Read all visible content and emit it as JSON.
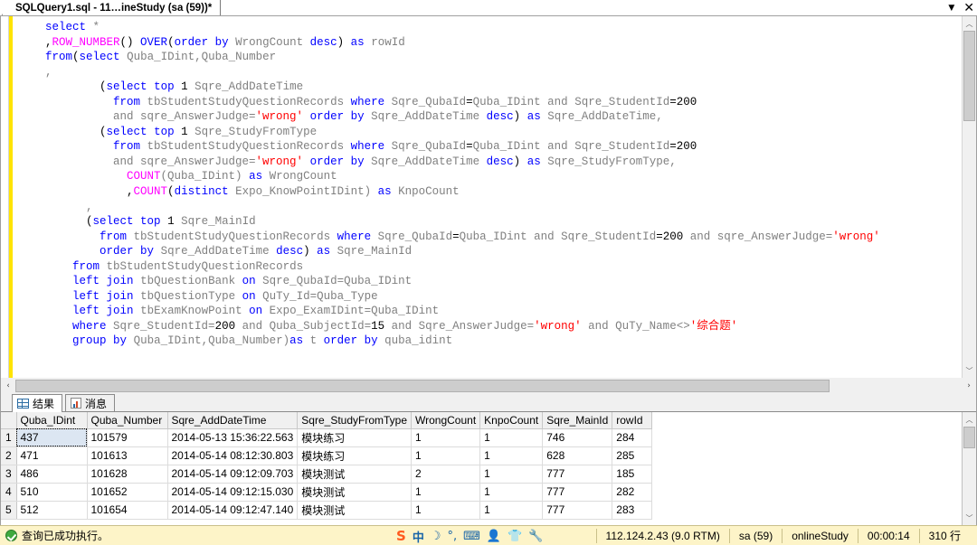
{
  "titlebar": {
    "tab_label": "SQLQuery1.sql - 11…ineStudy (sa (59))*",
    "chevron": "▼",
    "close": "✕"
  },
  "editor": {
    "lines": [
      [
        {
          "t": "    ",
          "c": "plain"
        },
        {
          "t": "select",
          "c": "kw"
        },
        {
          "t": " ",
          "c": "plain"
        },
        {
          "t": "*",
          "c": "id"
        }
      ],
      [
        {
          "t": "    ,",
          "c": "plain"
        },
        {
          "t": "ROW_NUMBER",
          "c": "fn"
        },
        {
          "t": "() ",
          "c": "plain"
        },
        {
          "t": "OVER",
          "c": "kw"
        },
        {
          "t": "(",
          "c": "plain"
        },
        {
          "t": "order",
          "c": "kw"
        },
        {
          "t": " ",
          "c": "plain"
        },
        {
          "t": "by",
          "c": "kw"
        },
        {
          "t": " WrongCount ",
          "c": "id"
        },
        {
          "t": "desc",
          "c": "kw"
        },
        {
          "t": ") ",
          "c": "plain"
        },
        {
          "t": "as",
          "c": "kw"
        },
        {
          "t": " rowId",
          "c": "id"
        }
      ],
      [
        {
          "t": "    ",
          "c": "plain"
        },
        {
          "t": "from",
          "c": "kw"
        },
        {
          "t": "(",
          "c": "plain"
        },
        {
          "t": "select",
          "c": "kw"
        },
        {
          "t": " Quba_IDint,Quba_Number",
          "c": "id"
        }
      ],
      [
        {
          "t": "    ,",
          "c": "id"
        }
      ],
      [
        {
          "t": "            (",
          "c": "plain"
        },
        {
          "t": "select",
          "c": "kw"
        },
        {
          "t": " ",
          "c": "plain"
        },
        {
          "t": "top",
          "c": "kw"
        },
        {
          "t": " ",
          "c": "plain"
        },
        {
          "t": "1",
          "c": "num"
        },
        {
          "t": " Sqre_AddDateTime",
          "c": "id"
        }
      ],
      [
        {
          "t": "              ",
          "c": "plain"
        },
        {
          "t": "from",
          "c": "kw"
        },
        {
          "t": " tbStudentStudyQuestionRecords ",
          "c": "id"
        },
        {
          "t": "where",
          "c": "kw"
        },
        {
          "t": " ",
          "c": "plain"
        },
        {
          "t": "Sqre_QubaId",
          "c": "id"
        },
        {
          "t": "=",
          "c": "plain"
        },
        {
          "t": "Quba_IDint",
          "c": "id"
        },
        {
          "t": " and ",
          "c": "id"
        },
        {
          "t": "Sqre_StudentId",
          "c": "id"
        },
        {
          "t": "=",
          "c": "plain"
        },
        {
          "t": "200",
          "c": "num"
        }
      ],
      [
        {
          "t": "              and sqre_AnswerJudge=",
          "c": "id"
        },
        {
          "t": "'wrong'",
          "c": "str"
        },
        {
          "t": " ",
          "c": "plain"
        },
        {
          "t": "order",
          "c": "kw"
        },
        {
          "t": " ",
          "c": "plain"
        },
        {
          "t": "by",
          "c": "kw"
        },
        {
          "t": " Sqre_AddDateTime ",
          "c": "id"
        },
        {
          "t": "desc",
          "c": "kw"
        },
        {
          "t": ") ",
          "c": "plain"
        },
        {
          "t": "as",
          "c": "kw"
        },
        {
          "t": " Sqre_AddDateTime,",
          "c": "id"
        }
      ],
      [
        {
          "t": "            (",
          "c": "plain"
        },
        {
          "t": "select",
          "c": "kw"
        },
        {
          "t": " ",
          "c": "plain"
        },
        {
          "t": "top",
          "c": "kw"
        },
        {
          "t": " ",
          "c": "plain"
        },
        {
          "t": "1",
          "c": "num"
        },
        {
          "t": " Sqre_StudyFromType",
          "c": "id"
        }
      ],
      [
        {
          "t": "              ",
          "c": "plain"
        },
        {
          "t": "from",
          "c": "kw"
        },
        {
          "t": " tbStudentStudyQuestionRecords ",
          "c": "id"
        },
        {
          "t": "where",
          "c": "kw"
        },
        {
          "t": " ",
          "c": "plain"
        },
        {
          "t": "Sqre_QubaId",
          "c": "id"
        },
        {
          "t": "=",
          "c": "plain"
        },
        {
          "t": "Quba_IDint",
          "c": "id"
        },
        {
          "t": " and ",
          "c": "id"
        },
        {
          "t": "Sqre_StudentId",
          "c": "id"
        },
        {
          "t": "=",
          "c": "plain"
        },
        {
          "t": "200",
          "c": "num"
        }
      ],
      [
        {
          "t": "              and sqre_AnswerJudge=",
          "c": "id"
        },
        {
          "t": "'wrong'",
          "c": "str"
        },
        {
          "t": " ",
          "c": "plain"
        },
        {
          "t": "order",
          "c": "kw"
        },
        {
          "t": " ",
          "c": "plain"
        },
        {
          "t": "by",
          "c": "kw"
        },
        {
          "t": " Sqre_AddDateTime ",
          "c": "id"
        },
        {
          "t": "desc",
          "c": "kw"
        },
        {
          "t": ") ",
          "c": "plain"
        },
        {
          "t": "as",
          "c": "kw"
        },
        {
          "t": " Sqre_StudyFromType,",
          "c": "id"
        }
      ],
      [
        {
          "t": "                ",
          "c": "plain"
        },
        {
          "t": "COUNT",
          "c": "fn"
        },
        {
          "t": "(Quba_IDint) ",
          "c": "id"
        },
        {
          "t": "as",
          "c": "kw"
        },
        {
          "t": " WrongCount",
          "c": "id"
        }
      ],
      [
        {
          "t": "                ,",
          "c": "plain"
        },
        {
          "t": "COUNT",
          "c": "fn"
        },
        {
          "t": "(",
          "c": "plain"
        },
        {
          "t": "distinct",
          "c": "kw"
        },
        {
          "t": " Expo_KnowPointIDint) ",
          "c": "id"
        },
        {
          "t": "as",
          "c": "kw"
        },
        {
          "t": " KnpoCount",
          "c": "id"
        }
      ],
      [
        {
          "t": "          ,",
          "c": "id"
        }
      ],
      [
        {
          "t": "          (",
          "c": "plain"
        },
        {
          "t": "select",
          "c": "kw"
        },
        {
          "t": " ",
          "c": "plain"
        },
        {
          "t": "top",
          "c": "kw"
        },
        {
          "t": " ",
          "c": "plain"
        },
        {
          "t": "1",
          "c": "num"
        },
        {
          "t": " Sqre_MainId",
          "c": "id"
        }
      ],
      [
        {
          "t": "            ",
          "c": "plain"
        },
        {
          "t": "from",
          "c": "kw"
        },
        {
          "t": " tbStudentStudyQuestionRecords ",
          "c": "id"
        },
        {
          "t": "where",
          "c": "kw"
        },
        {
          "t": " ",
          "c": "plain"
        },
        {
          "t": "Sqre_QubaId",
          "c": "id"
        },
        {
          "t": "=",
          "c": "plain"
        },
        {
          "t": "Quba_IDint",
          "c": "id"
        },
        {
          "t": " and ",
          "c": "id"
        },
        {
          "t": "Sqre_StudentId",
          "c": "id"
        },
        {
          "t": "=",
          "c": "plain"
        },
        {
          "t": "200",
          "c": "num"
        },
        {
          "t": " and sqre_AnswerJudge=",
          "c": "id"
        },
        {
          "t": "'wrong'",
          "c": "str"
        }
      ],
      [
        {
          "t": "            ",
          "c": "plain"
        },
        {
          "t": "order",
          "c": "kw"
        },
        {
          "t": " ",
          "c": "plain"
        },
        {
          "t": "by",
          "c": "kw"
        },
        {
          "t": " Sqre_AddDateTime ",
          "c": "id"
        },
        {
          "t": "desc",
          "c": "kw"
        },
        {
          "t": ") ",
          "c": "plain"
        },
        {
          "t": "as",
          "c": "kw"
        },
        {
          "t": " Sqre_MainId",
          "c": "id"
        }
      ],
      [
        {
          "t": "        ",
          "c": "plain"
        },
        {
          "t": "from",
          "c": "kw"
        },
        {
          "t": " tbStudentStudyQuestionRecords",
          "c": "id"
        }
      ],
      [
        {
          "t": "        ",
          "c": "plain"
        },
        {
          "t": "left",
          "c": "kw"
        },
        {
          "t": " ",
          "c": "plain"
        },
        {
          "t": "join",
          "c": "kw"
        },
        {
          "t": " tbQuestionBank ",
          "c": "id"
        },
        {
          "t": "on",
          "c": "kw"
        },
        {
          "t": " Sqre_QubaId=Quba_IDint",
          "c": "id"
        }
      ],
      [
        {
          "t": "        ",
          "c": "plain"
        },
        {
          "t": "left",
          "c": "kw"
        },
        {
          "t": " ",
          "c": "plain"
        },
        {
          "t": "join",
          "c": "kw"
        },
        {
          "t": " tbQuestionType ",
          "c": "id"
        },
        {
          "t": "on",
          "c": "kw"
        },
        {
          "t": " QuTy_Id=Quba_Type",
          "c": "id"
        }
      ],
      [
        {
          "t": "        ",
          "c": "plain"
        },
        {
          "t": "left",
          "c": "kw"
        },
        {
          "t": " ",
          "c": "plain"
        },
        {
          "t": "join",
          "c": "kw"
        },
        {
          "t": " tbExamKnowPoint ",
          "c": "id"
        },
        {
          "t": "on",
          "c": "kw"
        },
        {
          "t": " Expo_ExamIDint=Quba_IDint",
          "c": "id"
        }
      ],
      [
        {
          "t": "        ",
          "c": "plain"
        },
        {
          "t": "where",
          "c": "kw"
        },
        {
          "t": " Sqre_StudentId=",
          "c": "id"
        },
        {
          "t": "200",
          "c": "num"
        },
        {
          "t": " and Quba_SubjectId=",
          "c": "id"
        },
        {
          "t": "15",
          "c": "num"
        },
        {
          "t": " and Sqre_AnswerJudge=",
          "c": "id"
        },
        {
          "t": "'wrong'",
          "c": "str"
        },
        {
          "t": " and QuTy_Name<>",
          "c": "id"
        },
        {
          "t": "'综合题'",
          "c": "str"
        }
      ],
      [
        {
          "t": "        ",
          "c": "plain"
        },
        {
          "t": "group",
          "c": "kw"
        },
        {
          "t": " ",
          "c": "plain"
        },
        {
          "t": "by",
          "c": "kw"
        },
        {
          "t": " Quba_IDint,Quba_Number)",
          "c": "id"
        },
        {
          "t": "as",
          "c": "kw"
        },
        {
          "t": " t ",
          "c": "id"
        },
        {
          "t": "order",
          "c": "kw"
        },
        {
          "t": " ",
          "c": "plain"
        },
        {
          "t": "by",
          "c": "kw"
        },
        {
          "t": " quba_idint",
          "c": "id"
        }
      ]
    ],
    "scrollbar": {
      "up_arrow": "︿",
      "down_arrow": "﹀",
      "left_arrow": "‹",
      "right_arrow": "›"
    }
  },
  "results": {
    "tabs": [
      {
        "label": "结果",
        "icon": "grid-icon",
        "active": true
      },
      {
        "label": "消息",
        "icon": "message-icon",
        "active": false
      }
    ],
    "columns": [
      "Quba_IDint",
      "Quba_Number",
      "Sqre_AddDateTime",
      "Sqre_StudyFromType",
      "WrongCount",
      "KnpoCount",
      "Sqre_MainId",
      "rowId"
    ],
    "rows": [
      {
        "n": "1",
        "cells": [
          "437",
          "101579",
          "2014-05-13 15:36:22.563",
          "模块练习",
          "1",
          "1",
          "746",
          "284"
        ]
      },
      {
        "n": "2",
        "cells": [
          "471",
          "101613",
          "2014-05-14 08:12:30.803",
          "模块练习",
          "1",
          "1",
          "628",
          "285"
        ]
      },
      {
        "n": "3",
        "cells": [
          "486",
          "101628",
          "2014-05-14 09:12:09.703",
          "模块测试",
          "2",
          "1",
          "777",
          "185"
        ]
      },
      {
        "n": "4",
        "cells": [
          "510",
          "101652",
          "2014-05-14 09:12:15.030",
          "模块测试",
          "1",
          "1",
          "777",
          "282"
        ]
      },
      {
        "n": "5",
        "cells": [
          "512",
          "101654",
          "2014-05-14 09:12:47.140",
          "模块测试",
          "1",
          "1",
          "777",
          "283"
        ]
      }
    ]
  },
  "statusbar": {
    "message": "查询已成功执行。",
    "ime": {
      "logo": "S",
      "mode": "中",
      "moon": "☽",
      "punct": "°,",
      "keyboard": "⌨",
      "user": "👤",
      "skin": "👕",
      "tools": "🔧"
    },
    "server": "112.124.2.43 (9.0 RTM)",
    "login": "sa (59)",
    "database": "onlineStudy",
    "elapsed": "00:00:14",
    "rowcount": "310 行"
  },
  "colors": {
    "keyword": "#0000ff",
    "function": "#ff00ff",
    "string": "#ff0000",
    "identifier": "#808080",
    "status_bg": "#fdf4c8",
    "gutter_mark": "#ffe400",
    "selection": "#dce6f2"
  }
}
